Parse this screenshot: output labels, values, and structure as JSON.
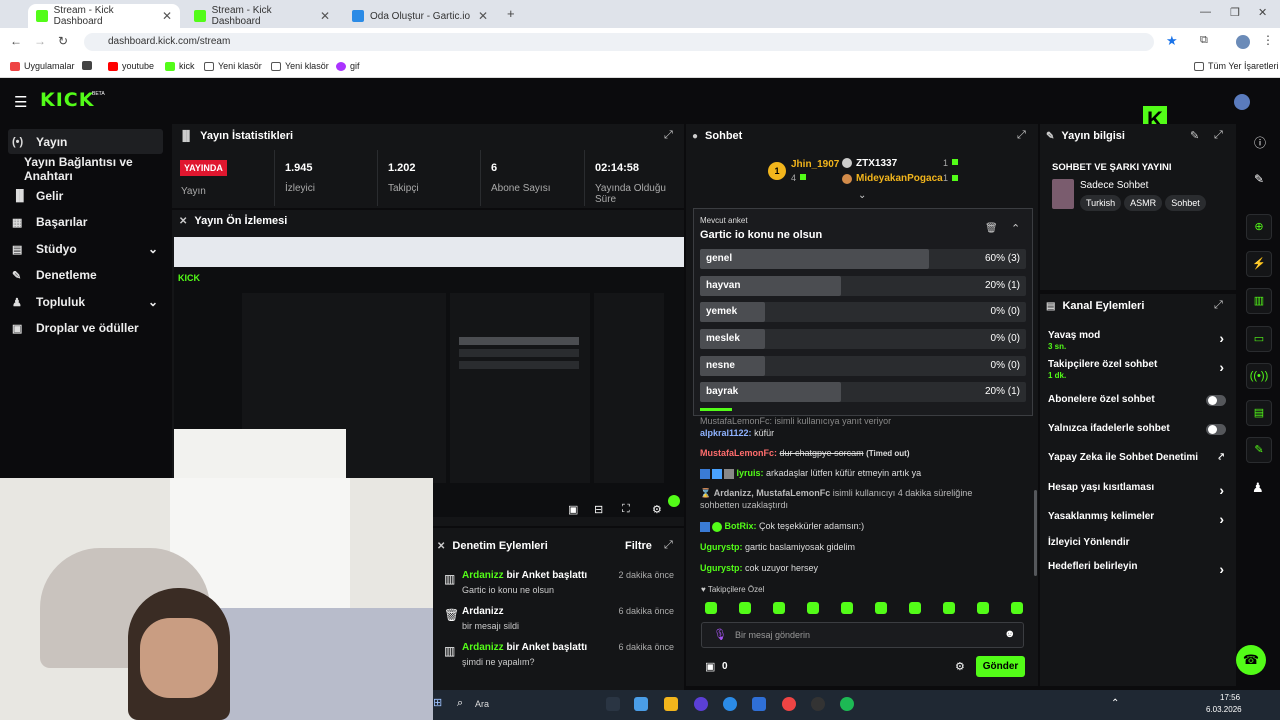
{
  "browser": {
    "tabs": [
      {
        "title": "Stream - Kick Dashboard",
        "active": true
      },
      {
        "title": "Stream - Kick Dashboard",
        "active": false
      },
      {
        "title": "Oda Oluştur - Gartic.io",
        "active": false
      }
    ],
    "url": "dashboard.kick.com/stream",
    "bookmarks": [
      "Uygulamalar",
      "youtube",
      "kick",
      "Yeni klasör",
      "Yeni klasör",
      "gif"
    ],
    "bookmarks_right": "Tüm Yer İşaretleri"
  },
  "kick": {
    "logo": "KICK",
    "logo_beta": "BETA",
    "sidebar": [
      {
        "label": "Yayın",
        "icon": "broadcast-icon"
      },
      {
        "label": "Yayın Bağlantısı ve Anahtarı",
        "icon": ""
      },
      {
        "label": "Gelir",
        "icon": "chart-icon"
      },
      {
        "label": "Başarılar",
        "icon": "trophy-icon"
      },
      {
        "label": "Stüdyo",
        "icon": "studio-icon"
      },
      {
        "label": "Denetleme",
        "icon": "wrench-icon"
      },
      {
        "label": "Topluluk",
        "icon": "community-icon"
      },
      {
        "label": "Droplar ve ödüller",
        "icon": "gift-icon"
      }
    ],
    "stats": {
      "title": "Yayın İstatistikleri",
      "live_badge": "YAYINDA",
      "items": [
        {
          "value": "",
          "label": "Yayın"
        },
        {
          "value": "1.945",
          "label": "İzleyici"
        },
        {
          "value": "1.202",
          "label": "Takipçi"
        },
        {
          "value": "6",
          "label": "Abone Sayısı"
        },
        {
          "value": "02:14:58",
          "label": "Yayında Olduğu Süre"
        }
      ]
    },
    "preview": {
      "title": "Yayın Ön İzlemesi"
    },
    "mod_log": {
      "title": "Denetim Eylemleri",
      "filter": "Filtre",
      "rows": [
        {
          "user": "Ardanizz",
          "action": "bir Anket başlattı",
          "detail": "Gartic io konu ne olsun",
          "time": "2 dakika önce"
        },
        {
          "user": "Ardanizz",
          "action": "",
          "detail": "bir mesajı sildi",
          "time": "6 dakika önce"
        },
        {
          "user": "Ardanizz",
          "action": "bir Anket başlattı",
          "detail": "şimdi ne yapalım?",
          "time": "6 dakika önce"
        }
      ]
    },
    "chat": {
      "title": "Sohbet",
      "leaderboard": [
        {
          "name": "Jhin_1907",
          "count": "4"
        },
        {
          "name": "ZTX1337",
          "count": "1"
        },
        {
          "name": "MideyakanPogaca",
          "count": "1"
        }
      ],
      "poll": {
        "label": "Mevcut anket",
        "question": "Gartic io konu ne olsun",
        "options": [
          {
            "label": "genel",
            "pct": "60% (3)",
            "fraction": 0.6
          },
          {
            "label": "hayvan",
            "pct": "20% (1)",
            "fraction": 0.2
          },
          {
            "label": "yemek",
            "pct": "0% (0)",
            "fraction": 0
          },
          {
            "label": "meslek",
            "pct": "0% (0)",
            "fraction": 0
          },
          {
            "label": "nesne",
            "pct": "0% (0)",
            "fraction": 0
          },
          {
            "label": "bayrak",
            "pct": "20% (1)",
            "fraction": 0.2
          }
        ]
      },
      "messages": [
        {
          "user": "MustafaLemonFc:",
          "text": "isimli kullanıcıya yanıt veriyor"
        },
        {
          "user": "alpkral1122:",
          "text": "küfür"
        },
        {
          "user": "MustafaLemonFc:",
          "text": "dur chatgpye sorcam",
          "note": "(Timed out)"
        },
        {
          "user": "lyruis:",
          "text": "arkadaşlar lütfen küfür etmeyin artık ya"
        },
        {
          "user": "Ardanizz, MustafaLemonFc",
          "text": "isimli kullanıcıyı 4 dakika süreliğine sohbetten uzaklaştırdı"
        },
        {
          "user": "BotRix:",
          "text": "Çok teşekkürler adamsın:)"
        },
        {
          "user": "Ugurystp:",
          "text": "gartic baslamiyosak gidelim"
        },
        {
          "user": "Ugurystp:",
          "text": "cok uzuyor hersey"
        }
      ],
      "followers_only": "Takipçilere Özel",
      "input_placeholder": "Bir mesaj gönderin",
      "points": "0",
      "send": "Gönder"
    },
    "stream_info": {
      "title": "Yayın bilgisi",
      "stream_title": "SOHBET VE ŞARKI YAYINI",
      "category": "Sadece Sohbet",
      "tags": [
        "Turkish",
        "ASMR",
        "Sohbet"
      ]
    },
    "channel_actions": {
      "title": "Kanal Eylemleri",
      "items": [
        {
          "label": "Yavaş mod",
          "sub": "3 sn.",
          "control": "chevron"
        },
        {
          "label": "Takipçilere özel sohbet",
          "sub": "1 dk.",
          "control": "chevron"
        },
        {
          "label": "Abonelere özel sohbet",
          "sub": "",
          "control": "toggle"
        },
        {
          "label": "Yalnızca ifadelerle sohbet",
          "sub": "",
          "control": "toggle"
        },
        {
          "label": "Yapay Zeka ile Sohbet Denetimi",
          "sub": "",
          "control": "external"
        },
        {
          "label": "Hesap yaşı kısıtlaması",
          "sub": "",
          "control": "chevron"
        },
        {
          "label": "Yasaklanmış kelimeler",
          "sub": "",
          "control": "chevron"
        },
        {
          "label": "İzleyici Yönlendir",
          "sub": "",
          "control": "none"
        },
        {
          "label": "Hedefleri belirleyin",
          "sub": "",
          "control": "chevron"
        }
      ]
    }
  },
  "taskbar": {
    "search": "Ara",
    "time": "17:56",
    "date": "6.03.2026"
  },
  "colors": {
    "kick_green": "#53fc18",
    "live_red": "#e0172f",
    "panel": "#141517"
  }
}
